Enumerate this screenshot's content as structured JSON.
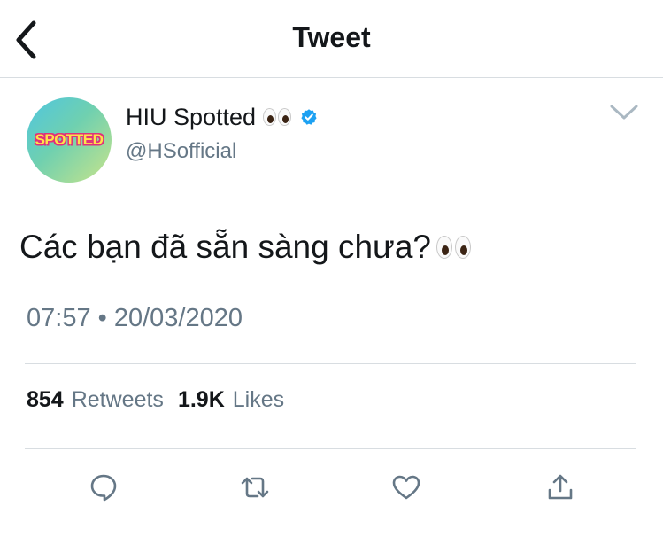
{
  "header": {
    "title": "Tweet",
    "back_icon": "chevron-left-icon"
  },
  "author": {
    "name": "HIU Spotted",
    "name_emoji": "eyes-emoji",
    "verified_icon": "verified-badge-icon",
    "handle": "@HSofficial",
    "avatar_text": "SPOTTED"
  },
  "tweet": {
    "text": "Các bạn đã sẵn sàng chưa?",
    "trailing_emoji": "eyes-emoji"
  },
  "meta": {
    "time": "07:57",
    "separator": "•",
    "date": "20/03/2020"
  },
  "stats": {
    "retweets_count": "854",
    "retweets_label": "Retweets",
    "likes_count": "1.9K",
    "likes_label": "Likes"
  },
  "actions": [
    "reply-icon",
    "retweet-icon",
    "like-icon",
    "share-icon"
  ],
  "colors": {
    "verified": "#1da1f2",
    "icon": "#657786",
    "text": "#14171a",
    "secondary": "#657786",
    "divider": "#d8dde1"
  }
}
